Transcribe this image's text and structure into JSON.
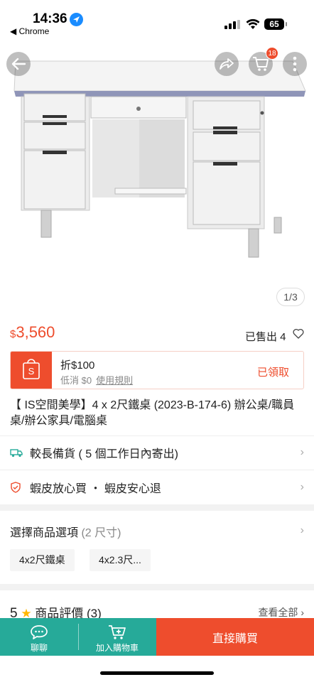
{
  "status_bar": {
    "time": "14:36",
    "back_app": "◀ Chrome",
    "battery": "65"
  },
  "top_nav": {
    "cart_count": "18"
  },
  "gallery": {
    "indicator": "1/3"
  },
  "price": {
    "currency": "$",
    "amount": "3,560"
  },
  "sold": {
    "label": "已售出 4"
  },
  "voucher": {
    "title": "折$100",
    "min_spend": "低消 $0",
    "rules": "使用規則",
    "status": "已領取"
  },
  "product_title": "【 IS空間美學】4 x 2尺鐵桌 (2023-B-174-6) 辦公桌/職員桌/辦公家具/電腦桌",
  "shipping": {
    "label": "較長備貨 ( 5 個工作日內寄出)"
  },
  "guarantee": {
    "label": "蝦皮放心買 ・ 蝦皮安心退"
  },
  "options": {
    "title": "選擇商品選項",
    "count": "(2 尺寸)",
    "items": [
      "4x2尺鐵桌",
      "4x2.3尺..."
    ]
  },
  "reviews": {
    "score": "5",
    "title": "商品評價 (3)",
    "see_all": "查看全部"
  },
  "bottom_bar": {
    "chat": "聊聊",
    "add_to_cart": "加入購物車",
    "buy_now": "直接購買"
  },
  "colors": {
    "accent": "#ee4d2d",
    "teal": "#26aa99"
  }
}
